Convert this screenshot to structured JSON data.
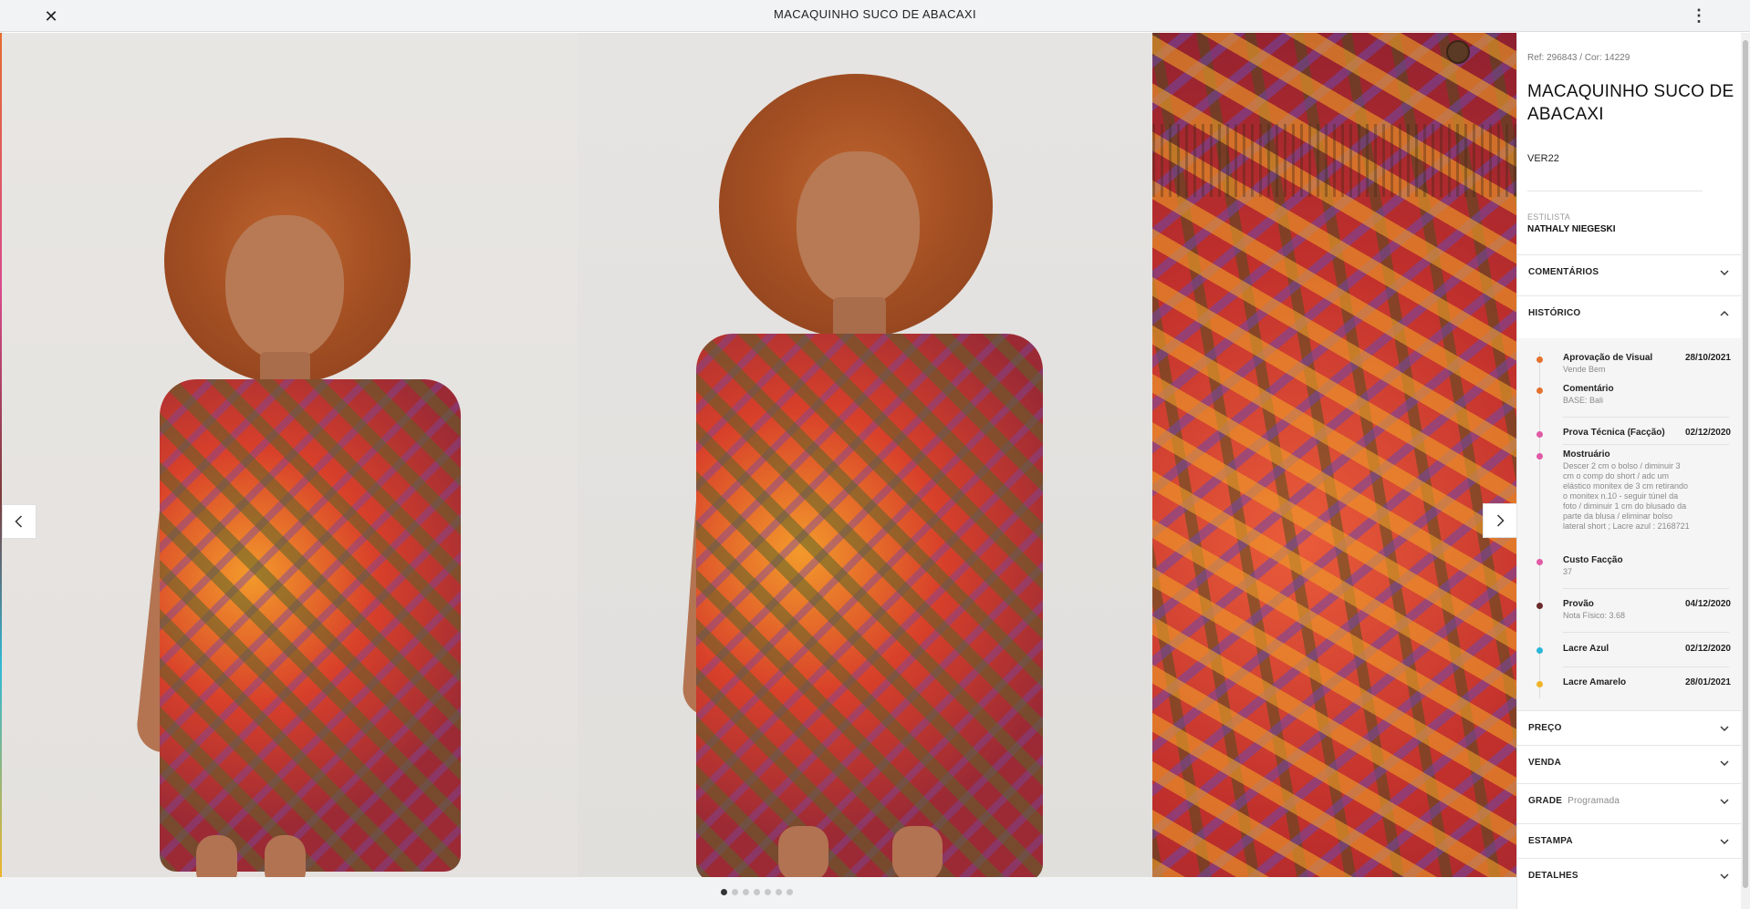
{
  "header": {
    "close_label": "✕",
    "title": "MACAQUINHO SUCO DE ABACAXI",
    "more_label": "⋮"
  },
  "gallery": {
    "slide_count": 7,
    "active_index": 0,
    "prev_icon": "chevron-left-icon",
    "next_icon": "chevron-right-icon"
  },
  "panel": {
    "ref": "Ref: 296843 / Cor: 14229",
    "title": "MACAQUINHO SUCO DE ABACAXI",
    "season": "VER22",
    "stylist_label": "ESTILISTA",
    "stylist": "NATHALY NIEGESKI",
    "sections": {
      "comments": "COMENTÁRIOS",
      "history": "HISTÓRICO",
      "price": "PREÇO",
      "sale": "VENDA",
      "grid": "GRADE",
      "grid_status": "Programada",
      "print": "ESTAMPA",
      "details": "DETALHES"
    },
    "history": [
      {
        "title": "Aprovação de Visual",
        "date": "28/10/2021",
        "sub": "Vende Bem",
        "color": "#e4722f"
      },
      {
        "title": "Comentário",
        "date": "",
        "sub": "BASE: Bali",
        "color": "#e4722f"
      },
      {
        "title": "Prova Técnica (Facção)",
        "date": "02/12/2020",
        "sub": "",
        "color": "#e05aa6"
      },
      {
        "title": "Mostruário",
        "date": "",
        "sub": "Descer 2 cm o bolso / diminuir 3 cm o comp do short / adc um elástico monitex de 3 cm retirando o monitex n.10 - seguir túnel da foto / diminuir 1 cm do blusado da parte da blusa / eliminar bolso lateral short ; Lacre azul : 2168721",
        "color": "#e05aa6"
      },
      {
        "title": "Custo Facção",
        "date": "",
        "sub": "37",
        "color": "#e05aa6"
      },
      {
        "title": "Provão",
        "date": "04/12/2020",
        "sub": "Nota Físico: 3.68",
        "color": "#6b2a2a"
      },
      {
        "title": "Lacre Azul",
        "date": "02/12/2020",
        "sub": "",
        "color": "#2bb7d9"
      },
      {
        "title": "Lacre Amarelo",
        "date": "28/01/2021",
        "sub": "",
        "color": "#f0b429"
      }
    ]
  }
}
